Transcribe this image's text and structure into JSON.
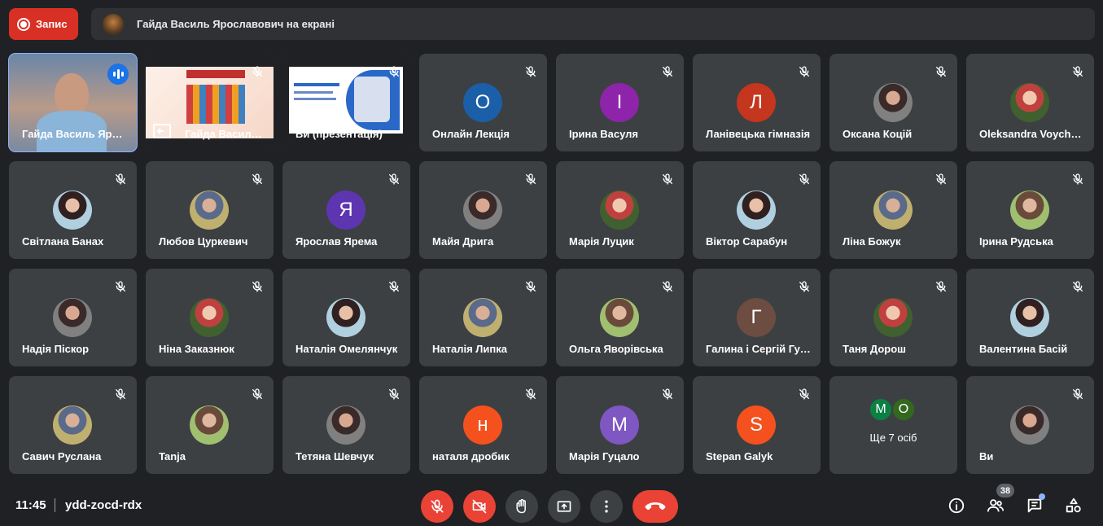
{
  "top": {
    "record_label": "Запис",
    "presenting_text": "Гайда Василь Ярославович на екрані"
  },
  "tiles": [
    {
      "name": "Гайда Василь Ярославович",
      "kind": "video-speaker"
    },
    {
      "name": "Гайда Василь Ярославович",
      "kind": "presentation"
    },
    {
      "name": "Ви (презентація)",
      "kind": "presentation-self"
    },
    {
      "name": "Онлайн Лекція",
      "initial": "О",
      "color": "#1a5fa8"
    },
    {
      "name": "Ірина Васуля",
      "initial": "І",
      "color": "#8e24aa"
    },
    {
      "name": "Ланівецька гімназія",
      "initial": "Л",
      "color": "#c4361d"
    },
    {
      "name": "Оксана Коцій",
      "photo": true
    },
    {
      "name": "Oleksandra Voychyshyn",
      "photo": true
    },
    {
      "name": "Світлана Банах",
      "photo": true
    },
    {
      "name": "Любов Цуркевич",
      "photo": true
    },
    {
      "name": "Ярослав Ярема",
      "initial": "Я",
      "color": "#5e35b1"
    },
    {
      "name": "Майя Дрига",
      "photo": true
    },
    {
      "name": "Марія Луцик",
      "photo": true
    },
    {
      "name": "Віктор Сарабун",
      "photo": true
    },
    {
      "name": "Ліна Божук",
      "photo": true
    },
    {
      "name": "Ірина Рудська",
      "photo": true
    },
    {
      "name": "Надія Піскор",
      "photo": true
    },
    {
      "name": "Ніна Заказнюк",
      "photo": true
    },
    {
      "name": "Наталія Омелянчук",
      "photo": true
    },
    {
      "name": "Наталія Липка",
      "photo": true
    },
    {
      "name": "Ольга Яворівська",
      "photo": true
    },
    {
      "name": "Галина і Сергій Гуменюки",
      "initial": "Г",
      "color": "#6d4c41"
    },
    {
      "name": "Таня Дорош",
      "photo": true
    },
    {
      "name": "Валентина Басій",
      "photo": true
    },
    {
      "name": "Савич Руслана",
      "photo": true
    },
    {
      "name": "Tanja",
      "photo": true
    },
    {
      "name": "Тетяна Шевчук",
      "photo": true
    },
    {
      "name": "наталя дробик",
      "initial": "н",
      "color": "#f4511e"
    },
    {
      "name": "Марія Гуцало",
      "initial": "М",
      "color": "#7e57c2"
    },
    {
      "name": "Stepan Galyk",
      "initial": "S",
      "color": "#f4511e"
    },
    {
      "name": "Ще 7 осіб",
      "kind": "more",
      "avatars": [
        {
          "initial": "М",
          "color": "#0b8043"
        },
        {
          "initial": "О",
          "color": "#33691e"
        }
      ]
    },
    {
      "name": "Ви",
      "photo": true
    }
  ],
  "bottom": {
    "time": "11:45",
    "meeting_code": "ydd-zocd-rdx",
    "participant_count": "38"
  },
  "colors": {
    "background": "#202124",
    "tile": "#3c4043",
    "danger": "#ea4335",
    "accent": "#8ab4f8"
  }
}
